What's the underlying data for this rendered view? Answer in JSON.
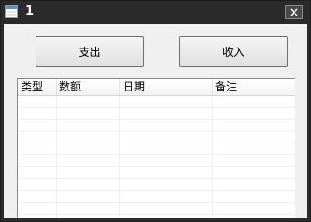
{
  "window": {
    "title": "1",
    "close_glyph": "✕"
  },
  "buttons": {
    "expense_label": "支出",
    "income_label": "收入"
  },
  "table": {
    "columns": [
      "类型",
      "数额",
      "日期",
      "备注"
    ],
    "rows": []
  }
}
